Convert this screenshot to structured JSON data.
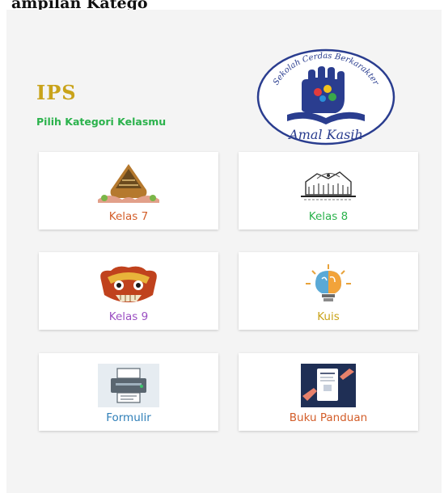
{
  "caption": "ampilan Katego",
  "app": {
    "title": "IPS",
    "subtitle": "Pilih Kategori Kelasmu"
  },
  "logo": {
    "arc_text": "Sekolah Cerdas Berkarakter",
    "name": "Amal Kasih"
  },
  "colors": {
    "title": "#c9a31a",
    "subtitle": "#2bb24c",
    "screen_bg": "#f4f4f4",
    "card_bg": "#ffffff"
  },
  "menu": [
    {
      "label": "Kelas 7",
      "icon": "wayang-gunungan-icon",
      "color": "#d35e2a"
    },
    {
      "label": "Kelas 8",
      "icon": "landmark-sketch-icon",
      "color": "#2bb24c"
    },
    {
      "label": "Kelas 9",
      "icon": "barong-mask-icon",
      "color": "#9b4fc2"
    },
    {
      "label": "Kuis",
      "icon": "lightbulb-brain-icon",
      "color": "#c9a31a"
    },
    {
      "label": "Formulir",
      "icon": "form-printer-icon",
      "color": "#2f7fb8"
    },
    {
      "label": "Buku Panduan",
      "icon": "guide-book-icon",
      "color": "#d35e2a"
    }
  ]
}
